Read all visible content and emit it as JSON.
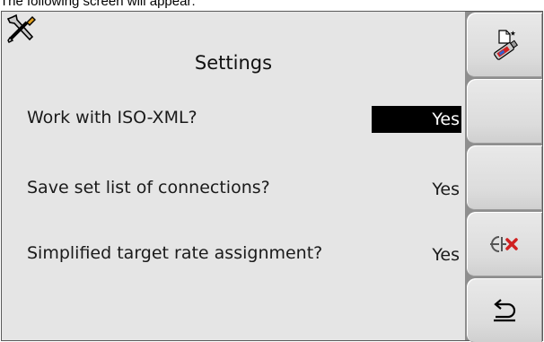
{
  "caption": "The following screen will appear:",
  "screen": {
    "app_icon": "tools-icon",
    "title": "Settings",
    "rows": [
      {
        "label": "Work with ISO-XML?",
        "value": "Yes",
        "selected": true
      },
      {
        "label": "Save set list of connections?",
        "value": "Yes",
        "selected": false
      },
      {
        "label": "Simplified target rate assignment?",
        "value": "Yes",
        "selected": false
      }
    ]
  },
  "softkeys": [
    {
      "icon": "usb-stick-icon"
    },
    {
      "icon": ""
    },
    {
      "icon": ""
    },
    {
      "icon": "disconnect-icon"
    },
    {
      "icon": "back-icon"
    }
  ],
  "colors": {
    "background": "#e5e5e5",
    "softkey_bar": "#8e8e8e",
    "selection": "#000000"
  }
}
